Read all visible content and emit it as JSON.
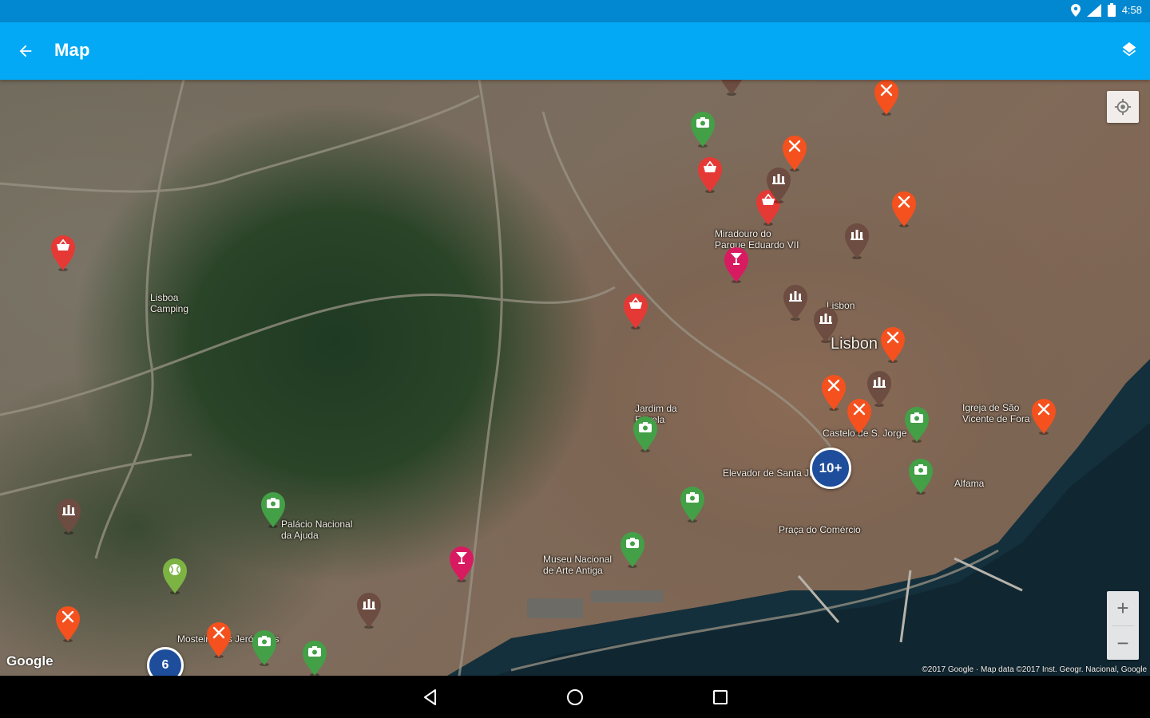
{
  "status_bar": {
    "time": "4:58",
    "icons": [
      "location-icon",
      "signal-icon",
      "battery-icon"
    ]
  },
  "app_bar": {
    "title": "Map",
    "back_icon": "arrow-back-icon",
    "layers_icon": "layers-icon",
    "background": "#03a9f4"
  },
  "map": {
    "labels": [
      {
        "text": "Lisboa\nCamping",
        "name": "label-lisboa-camping"
      },
      {
        "text": "Miradouro do\nParque Eduardo VII",
        "name": "label-miradouro"
      },
      {
        "text": "Lisbon",
        "name": "label-lisbon-small"
      },
      {
        "text": "Lisbon",
        "name": "label-lisbon-big"
      },
      {
        "text": "Jardim da\nEstrela",
        "name": "label-jardim-estrela"
      },
      {
        "text": "Igreja de São\nVicente de Fora",
        "name": "label-igreja-sao-vicente"
      },
      {
        "text": "Elevador de Santa Justa",
        "name": "label-elevador"
      },
      {
        "text": "Alfama",
        "name": "label-alfama"
      },
      {
        "text": "Praça do Comércio",
        "name": "label-praca-comercio"
      },
      {
        "text": "Palácio Nacional\nda Ajuda",
        "name": "label-palacio-ajuda"
      },
      {
        "text": "Museu Nacional\nde Arte Antiga",
        "name": "label-museu-arte-antiga"
      },
      {
        "text": "Mosteiro dos Jerónimos",
        "name": "label-mosteiro"
      },
      {
        "text": "Castelo de S. Jorge",
        "name": "label-castelo"
      }
    ],
    "markers": [
      {
        "type": "restaurant",
        "color": "#f4511e"
      },
      {
        "type": "shopping",
        "color": "#e53935"
      },
      {
        "type": "sights",
        "color": "#43a047"
      },
      {
        "type": "museum",
        "color": "#6d4c41"
      },
      {
        "type": "nightlife",
        "color": "#d81b60"
      },
      {
        "type": "sports",
        "color": "#7cb342"
      }
    ],
    "clusters": [
      {
        "count": "10+",
        "name": "cluster-10plus"
      },
      {
        "count": "6",
        "name": "cluster-6"
      }
    ],
    "zoom_in": "+",
    "zoom_out": "−",
    "google_logo": "Google",
    "attribution": "©2017 Google · Map data ©2017 Inst. Geogr. Nacional, Google"
  },
  "nav_bar": {
    "back": "nav-back-icon",
    "home": "nav-home-icon",
    "recents": "nav-recents-icon"
  }
}
